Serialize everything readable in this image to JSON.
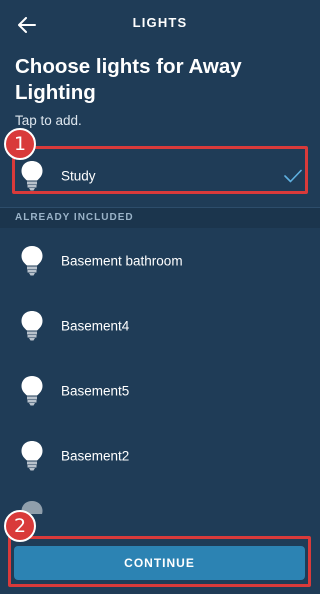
{
  "header": {
    "title": "LIGHTS",
    "back_icon": "arrow-left-icon"
  },
  "page": {
    "title": "Choose lights for Away Lighting",
    "subtitle": "Tap to add."
  },
  "selectable": [
    {
      "label": "Study",
      "selected": true,
      "icon": "lightbulb-icon"
    }
  ],
  "section": {
    "already_included_label": "ALREADY INCLUDED"
  },
  "included": [
    {
      "label": "Basement bathroom",
      "icon": "lightbulb-icon"
    },
    {
      "label": "Basement4",
      "icon": "lightbulb-icon"
    },
    {
      "label": "Basement5",
      "icon": "lightbulb-icon"
    },
    {
      "label": "Basement2",
      "icon": "lightbulb-icon"
    }
  ],
  "footer": {
    "continue_label": "CONTINUE"
  },
  "annotations": {
    "step1": "1",
    "step2": "2"
  },
  "colors": {
    "background": "#1f3c57",
    "accent_button": "#2c83b3",
    "annotation_red": "#d93a3a",
    "check_color": "#5fb0e0"
  }
}
